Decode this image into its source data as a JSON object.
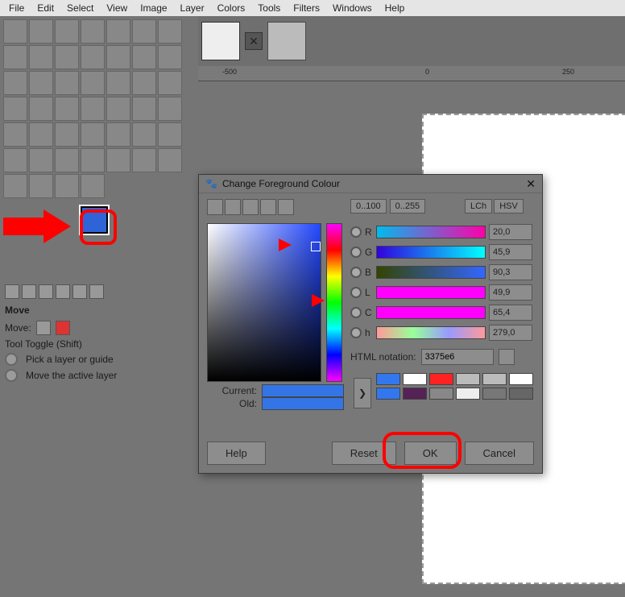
{
  "menubar": [
    "File",
    "Edit",
    "Select",
    "View",
    "Image",
    "Layer",
    "Colors",
    "Tools",
    "Filters",
    "Windows",
    "Help"
  ],
  "ruler": {
    "ticks": [
      "-500",
      "0",
      "250"
    ]
  },
  "tool_options": {
    "header": "Move",
    "label": "Move:",
    "toggle": "Tool Toggle  (Shift)",
    "opt1": "Pick a layer or guide",
    "opt2": "Move the active layer"
  },
  "dialog": {
    "title": "Change Foreground Colour",
    "range_a": "0..100",
    "range_b": "0..255",
    "model_a": "LCh",
    "model_b": "HSV",
    "ch": {
      "R": {
        "label": "R",
        "value": "20,0"
      },
      "G": {
        "label": "G",
        "value": "45,9"
      },
      "B": {
        "label": "B",
        "value": "90,3"
      },
      "L": {
        "label": "L",
        "value": "49,9"
      },
      "C": {
        "label": "C",
        "value": "65,4"
      },
      "h": {
        "label": "h",
        "value": "279,0"
      }
    },
    "html_label": "HTML notation:",
    "html_value": "3375e6",
    "current": "Current:",
    "old": "Old:",
    "help": "Help",
    "reset": "Reset",
    "ok": "OK",
    "cancel": "Cancel",
    "swatches": [
      "#37e",
      "#fff",
      "#f22",
      "#bbb",
      "#bbb",
      "#fff",
      "#37e",
      "#525",
      "#888",
      "#eee",
      "#777",
      "#666"
    ]
  },
  "colors": {
    "fg": "#2f64d8",
    "bg": "#ffffff",
    "current": "#3375e6",
    "old": "#3375e6"
  }
}
